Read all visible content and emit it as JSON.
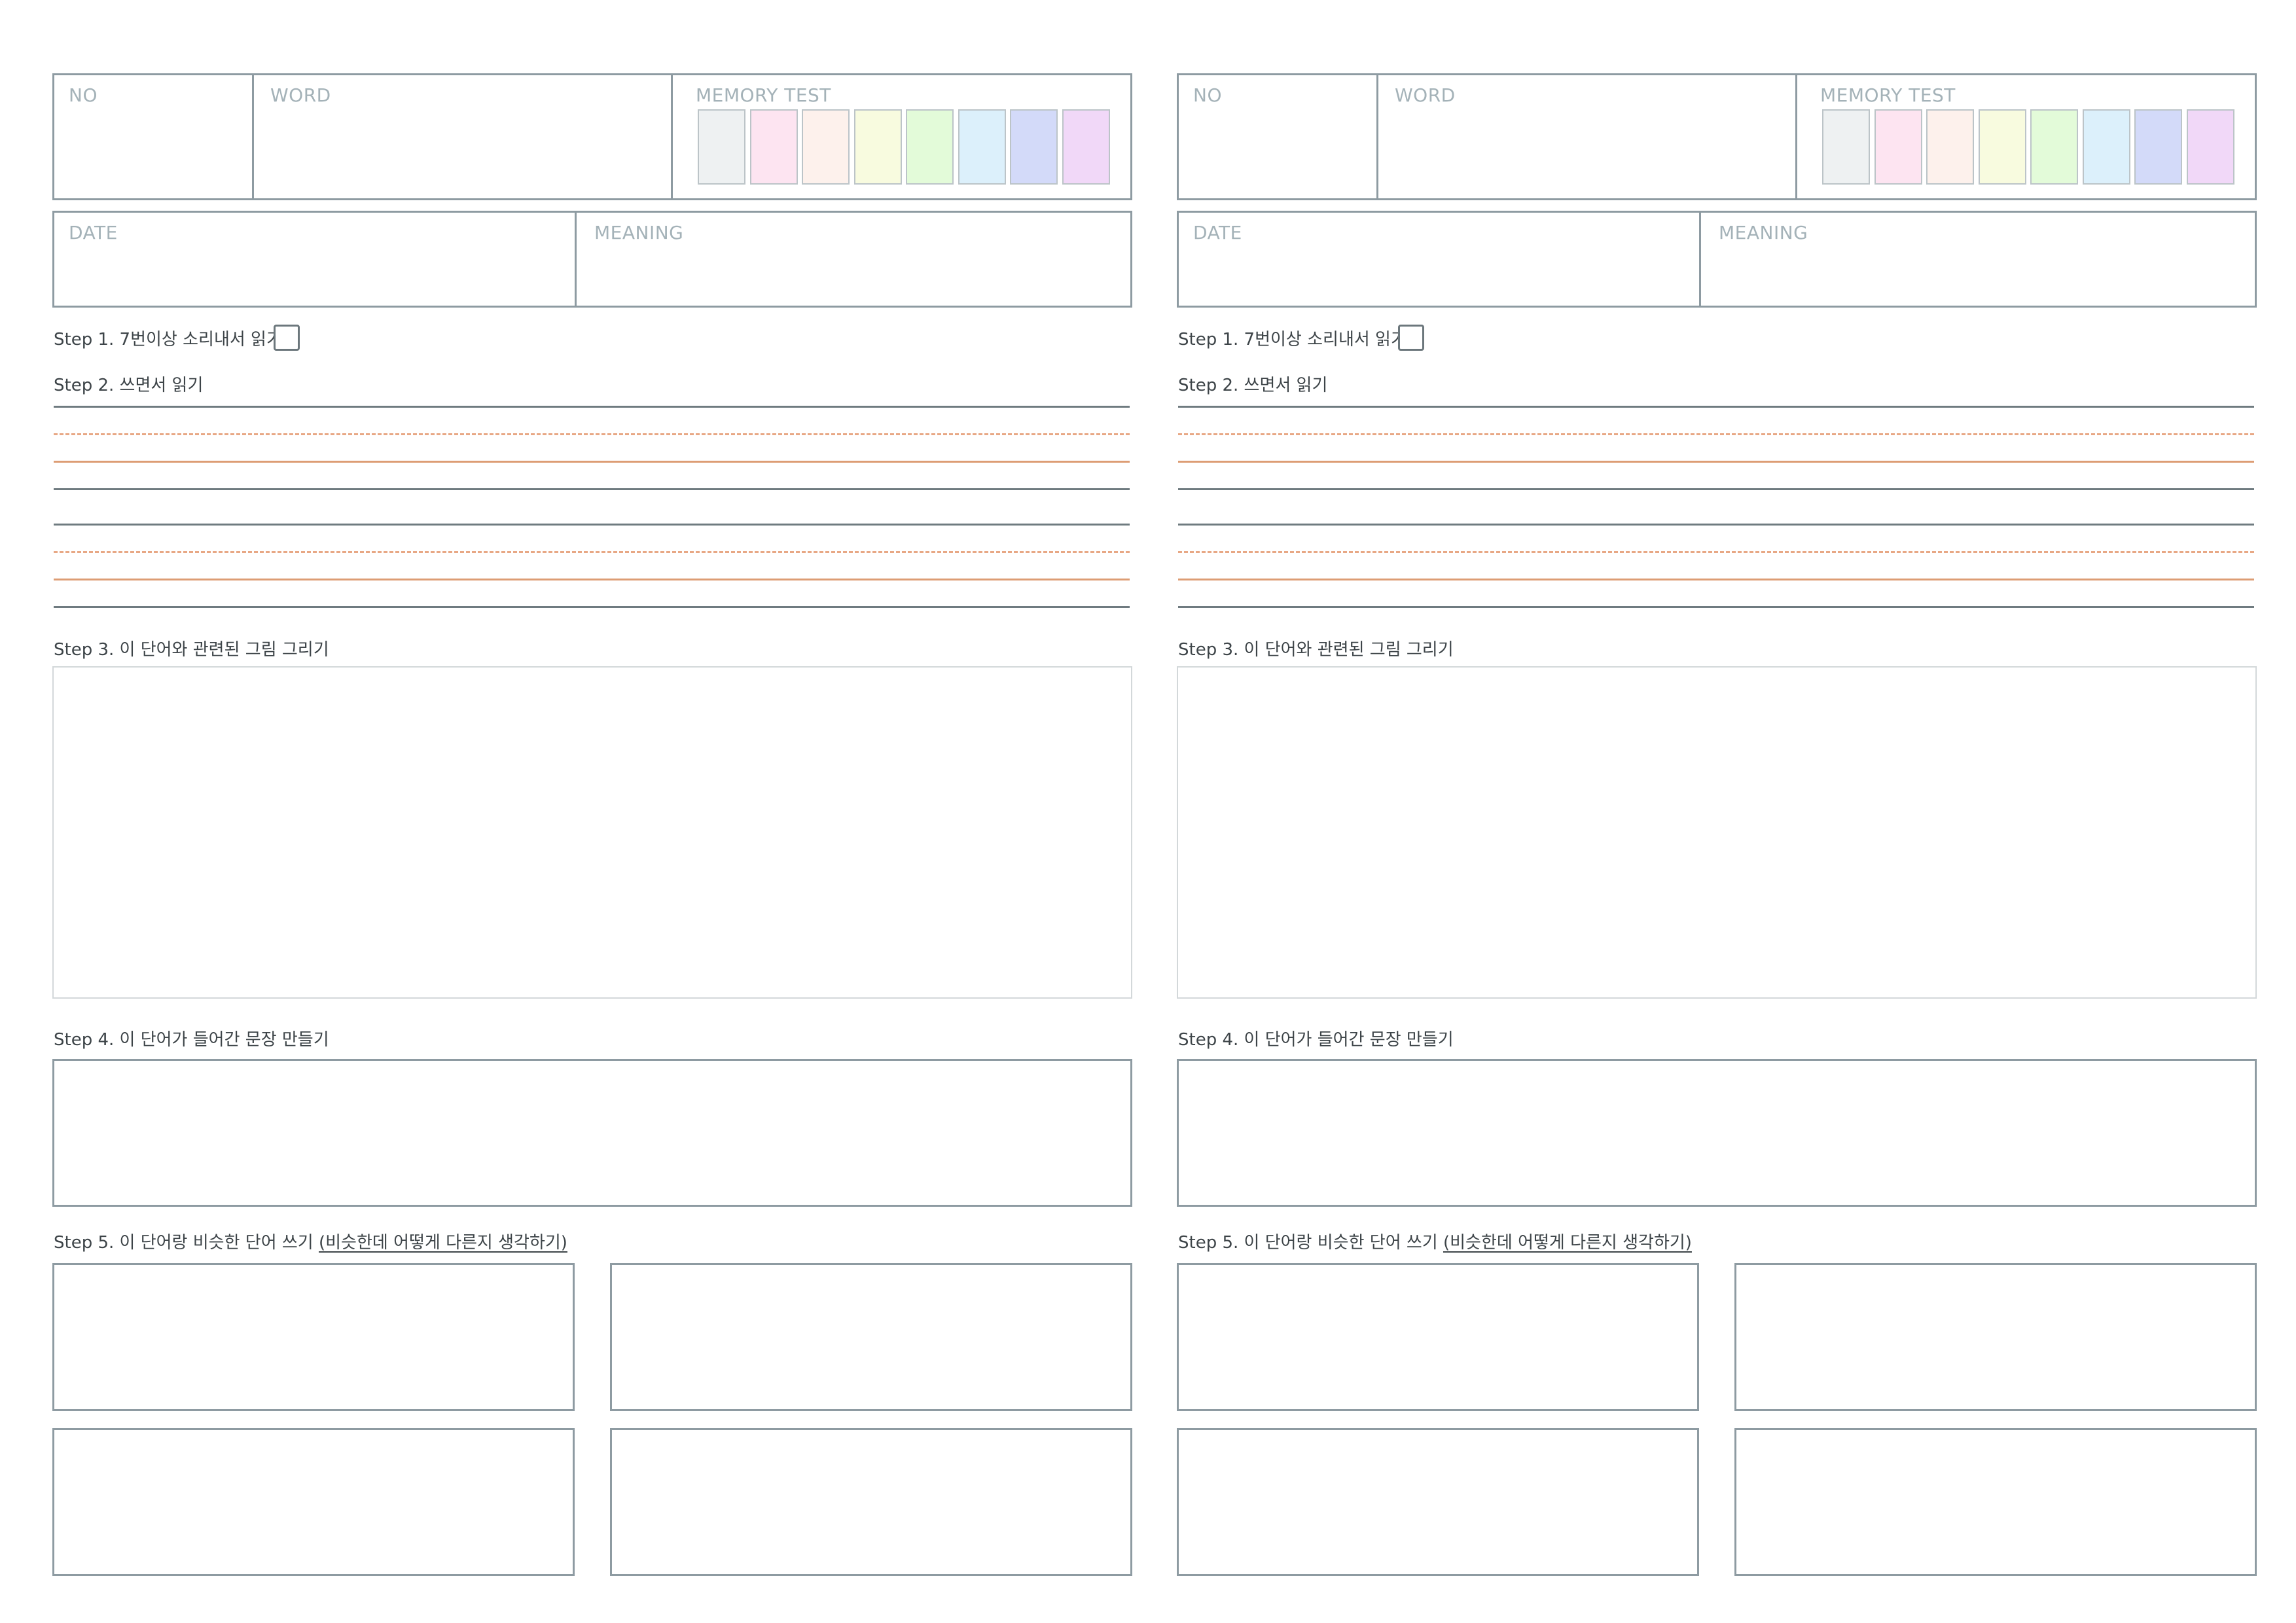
{
  "labels": {
    "no": "NO",
    "word": "WORD",
    "memory_test": "MEMORY TEST",
    "date": "DATE",
    "meaning": "MEANING"
  },
  "steps": {
    "step1": "Step 1. 7번이상 소리내서 읽기!",
    "step2": "Step 2. 쓰면서 읽기",
    "step3": "Step 3. 이 단어와 관련된 그림 그리기",
    "step4": "Step 4. 이 단어가 들어간 문장 만들기",
    "step5_main": "Step 5. 이 단어랑 비슷한 단어 쓰기 ",
    "step5_note": "(비슷한데 어떻게 다른지 생각하기)"
  },
  "memory_test_colors": [
    "#eef1f2",
    "#fde4f1",
    "#fdf1ec",
    "#f8fbdf",
    "#e3fbd9",
    "#dcf0fb",
    "#d3daf9",
    "#f1d8f8"
  ]
}
